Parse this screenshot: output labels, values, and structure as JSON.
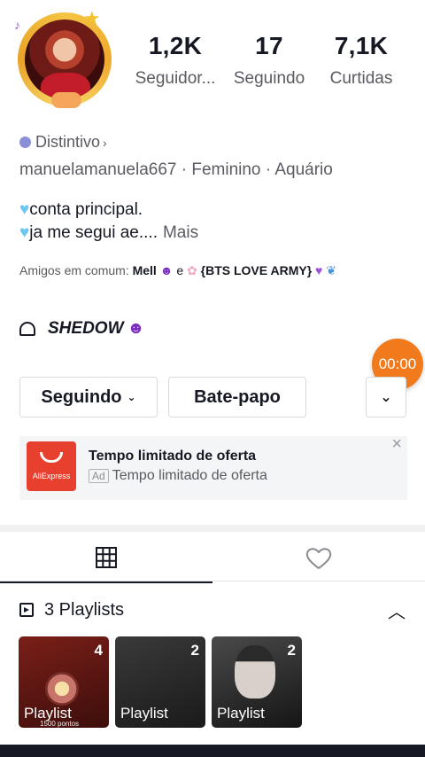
{
  "profile": {
    "username": "manuelamanuela667",
    "gender": "Feminino",
    "sign": "Aquário",
    "badge_label": "Distintivo"
  },
  "stats": [
    {
      "value": "1,2K",
      "label": "Seguidor..."
    },
    {
      "value": "17",
      "label": "Seguindo"
    },
    {
      "value": "7,1K",
      "label": "Curtidas"
    }
  ],
  "bio": {
    "line1": "conta principal.",
    "line2": "ja me segui ae....",
    "more": "Mais"
  },
  "friends": {
    "label": "Amigos em comum:",
    "name1": "Mell",
    "connector": "e",
    "name2": "{BTS LOVE ARMY}"
  },
  "shedow": "SHEDOW",
  "timer": "00:00",
  "buttons": {
    "following": "Seguindo",
    "chat": "Bate-papo"
  },
  "ad": {
    "brand": "AliExpress",
    "title": "Tempo limitado de oferta",
    "tag": "Ad",
    "subtitle": "Tempo limitado de oferta"
  },
  "playlists": {
    "title": "3 Playlists",
    "items": [
      {
        "label": "Playlist",
        "count": "4",
        "caption": "1500 pontos"
      },
      {
        "label": "Playlist",
        "count": "2"
      },
      {
        "label": "Playlist",
        "count": "2"
      }
    ]
  },
  "colors": {
    "timer": "#f07a1c",
    "ad_logo": "#e8402e",
    "heart_emoji": "#6cc8f0"
  }
}
